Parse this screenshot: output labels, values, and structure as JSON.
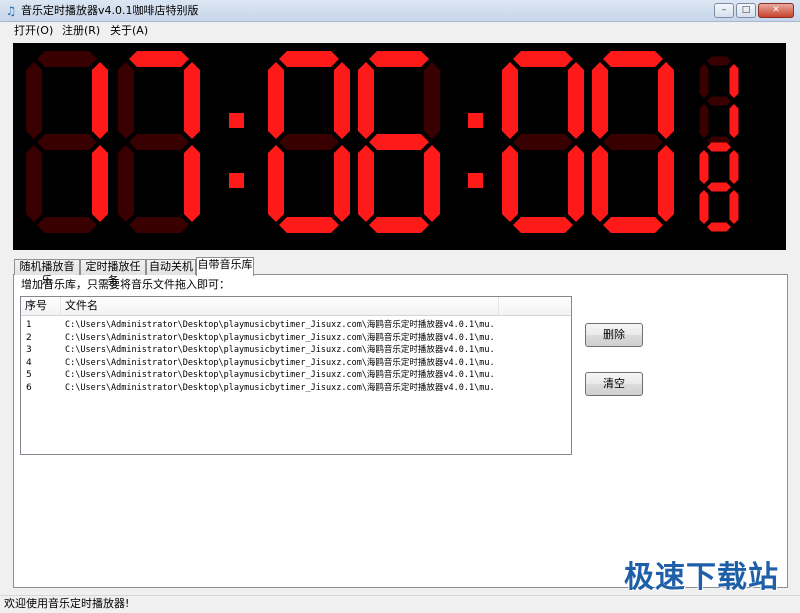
{
  "window": {
    "title": "音乐定时播放器v4.0.1咖啡店特别版",
    "icon": "music-note-icon",
    "controls": [
      "minimize-icon",
      "maximize-icon",
      "close-icon"
    ]
  },
  "menu": [
    {
      "label": "打开(O)"
    },
    {
      "label": "注册(R)"
    },
    {
      "label": "关于(A)"
    }
  ],
  "clock": {
    "displayed_digits": [
      "1",
      "7",
      "0",
      "6",
      "0",
      "0"
    ],
    "seconds_fraction_digits": [
      "1",
      "8"
    ],
    "lit_color": "#ff1a1a",
    "dim_color": "#380000"
  },
  "tabs": [
    {
      "label": "随机播放音乐",
      "active": false
    },
    {
      "label": "定时播放任务",
      "active": false
    },
    {
      "label": "自动关机",
      "active": false
    },
    {
      "label": "自带音乐库",
      "active": true
    }
  ],
  "library": {
    "hint": "增加音乐库，只需要将音乐文件拖入即可：",
    "columns": [
      "序号",
      "文件名"
    ],
    "rows": [
      {
        "index": "1",
        "path": "C:\\Users\\Administrator\\Desktop\\playmusicbytimer_Jisuxz.com\\海鸥音乐定时播放器v4.0.1\\mu..."
      },
      {
        "index": "2",
        "path": "C:\\Users\\Administrator\\Desktop\\playmusicbytimer_Jisuxz.com\\海鸥音乐定时播放器v4.0.1\\mu..."
      },
      {
        "index": "3",
        "path": "C:\\Users\\Administrator\\Desktop\\playmusicbytimer_Jisuxz.com\\海鸥音乐定时播放器v4.0.1\\mu..."
      },
      {
        "index": "4",
        "path": "C:\\Users\\Administrator\\Desktop\\playmusicbytimer_Jisuxz.com\\海鸥音乐定时播放器v4.0.1\\mu..."
      },
      {
        "index": "5",
        "path": "C:\\Users\\Administrator\\Desktop\\playmusicbytimer_Jisuxz.com\\海鸥音乐定时播放器v4.0.1\\mu..."
      },
      {
        "index": "6",
        "path": "C:\\Users\\Administrator\\Desktop\\playmusicbytimer_Jisuxz.com\\海鸥音乐定时播放器v4.0.1\\mu..."
      }
    ],
    "delete_label": "删除",
    "clear_label": "清空"
  },
  "status": {
    "text": "欢迎使用音乐定时播放器!"
  },
  "watermark": {
    "text": "极速下载站"
  }
}
